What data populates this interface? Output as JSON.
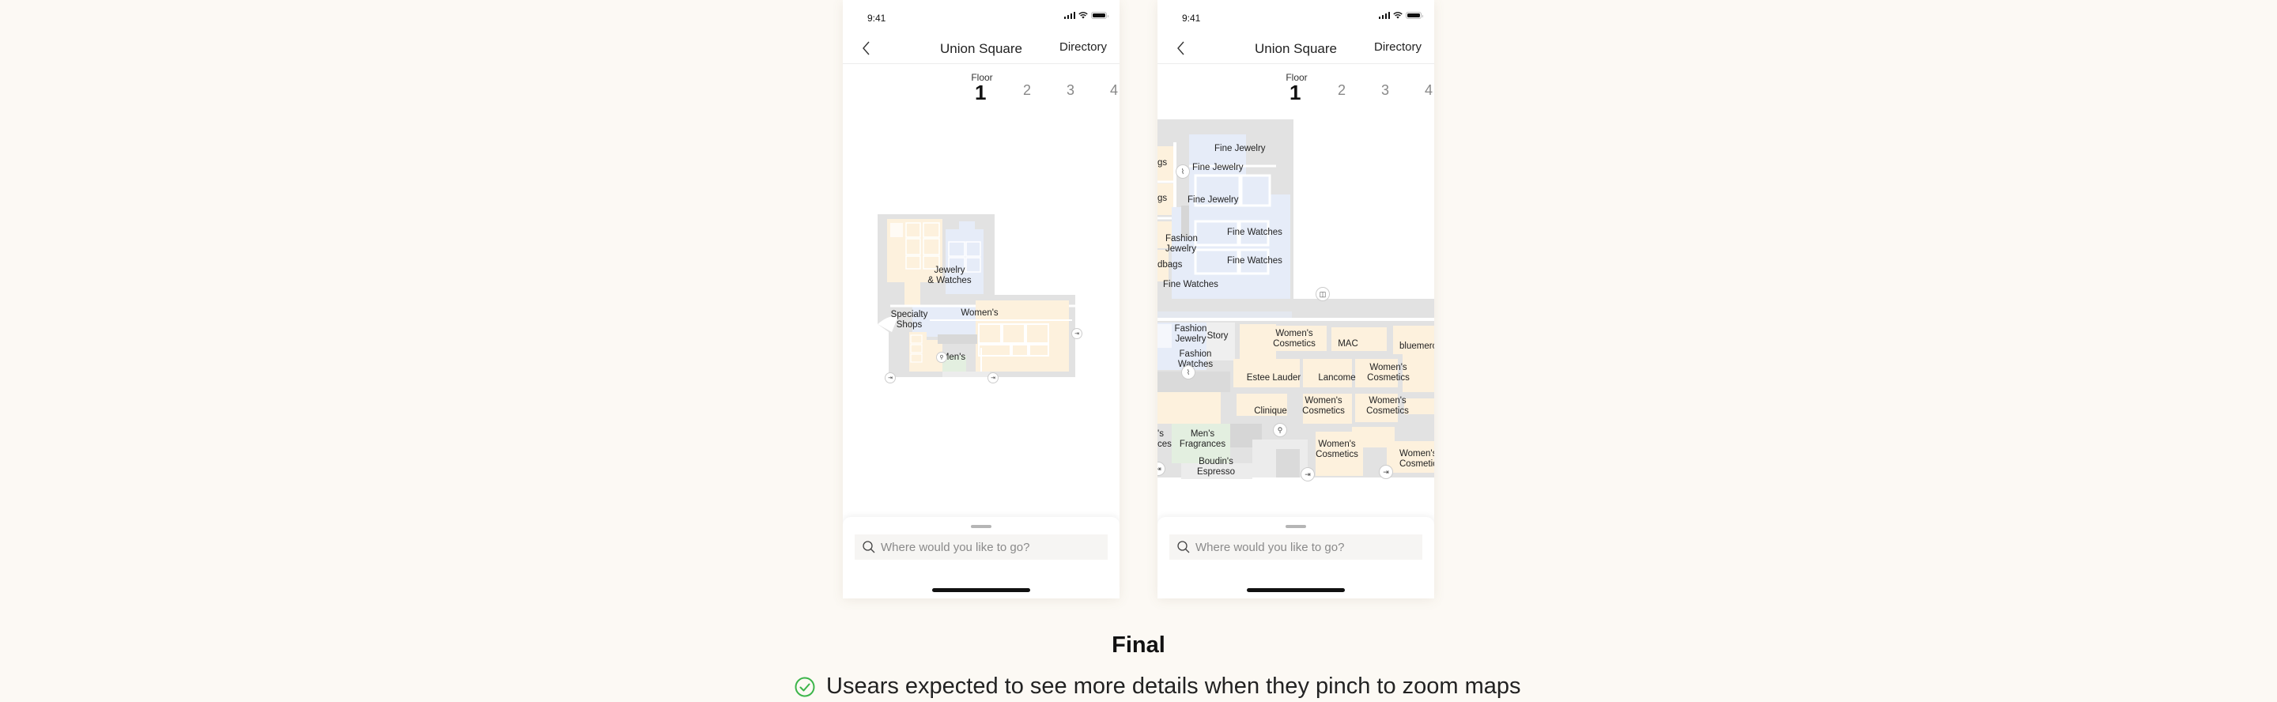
{
  "screens": [
    {
      "status": {
        "time": "9:41"
      },
      "nav": {
        "back_icon": "chevron-left-icon",
        "title": "Union Square",
        "directory_label": "Directory"
      },
      "floor": {
        "label": "Floor",
        "tabs": [
          "1",
          "2",
          "3",
          "4"
        ],
        "active": "1"
      },
      "map": {
        "zoom_state": "zoomed-out",
        "labels": {
          "jewelry_watches": "Jewelry\n& Watches",
          "womens": "Women's",
          "specialty_shops": "Specialty\nShops",
          "mens": "Men's"
        },
        "poi_icons": [
          "entrance-icon",
          "entrance-icon",
          "entrance-icon",
          "restroom-icon"
        ]
      },
      "search": {
        "placeholder": "Where would you like to go?",
        "value": ""
      }
    },
    {
      "status": {
        "time": "9:41"
      },
      "nav": {
        "back_icon": "chevron-left-icon",
        "title": "Union Square",
        "directory_label": "Directory"
      },
      "floor": {
        "label": "Floor",
        "tabs": [
          "1",
          "2",
          "3",
          "4"
        ],
        "active": "1"
      },
      "map": {
        "zoom_state": "zoomed-in",
        "labels": {
          "fine_jewelry_1": "Fine Jewelry",
          "fine_jewelry_2": "Fine Jewelry",
          "fine_jewelry_3": "Fine Jewelry",
          "bags_1": "gs",
          "bags_2": "gs",
          "fashion_jewelry_1": "Fashion\nJewelry",
          "handbags": "dbags",
          "fine_watches_1": "Fine Watches",
          "fine_watches_2": "Fine Watches",
          "fine_watches_3": "Fine Watches",
          "fashion_jewelry_2": "Fashion\nJewelry",
          "story": "Story",
          "fashion_watches": "Fashion\nWatches",
          "womens_cosmetics_1": "Women's\nCosmetics",
          "mac": "MAC",
          "bluemercury": "bluemercury",
          "estee_lauder": "Estee Lauder",
          "lancome": "Lancome",
          "womens_cosmetics_2": "Women's\nCosmetics",
          "clinique": "Clinique",
          "womens_cosmetics_3": "Women's\nCosmetics",
          "womens_cosmetics_4": "Women's\nCosmetics",
          "mens_accessories": "'s\nces",
          "mens_fragrances": "Men's\nFragrances",
          "womens_cosmetics_5": "Women's\nCosmetics",
          "womens_cosmetics_6": "Women's\nCosmetics",
          "boudins_espresso": "Boudin's\nEspresso"
        }
      },
      "search": {
        "placeholder": "Where would you like to go?",
        "value": ""
      }
    }
  ],
  "caption": {
    "title": "Final",
    "note": "Usears expected to see more details when they pinch to zoom maps",
    "note_icon": "check-circle-icon"
  },
  "colors": {
    "background": "#fcf9f4",
    "map_gray": "#e2e2e2",
    "map_blue": "#e6ecf8",
    "map_beige": "#fdf1dd",
    "map_green": "#e3efe0",
    "check_green": "#3cb54a"
  }
}
